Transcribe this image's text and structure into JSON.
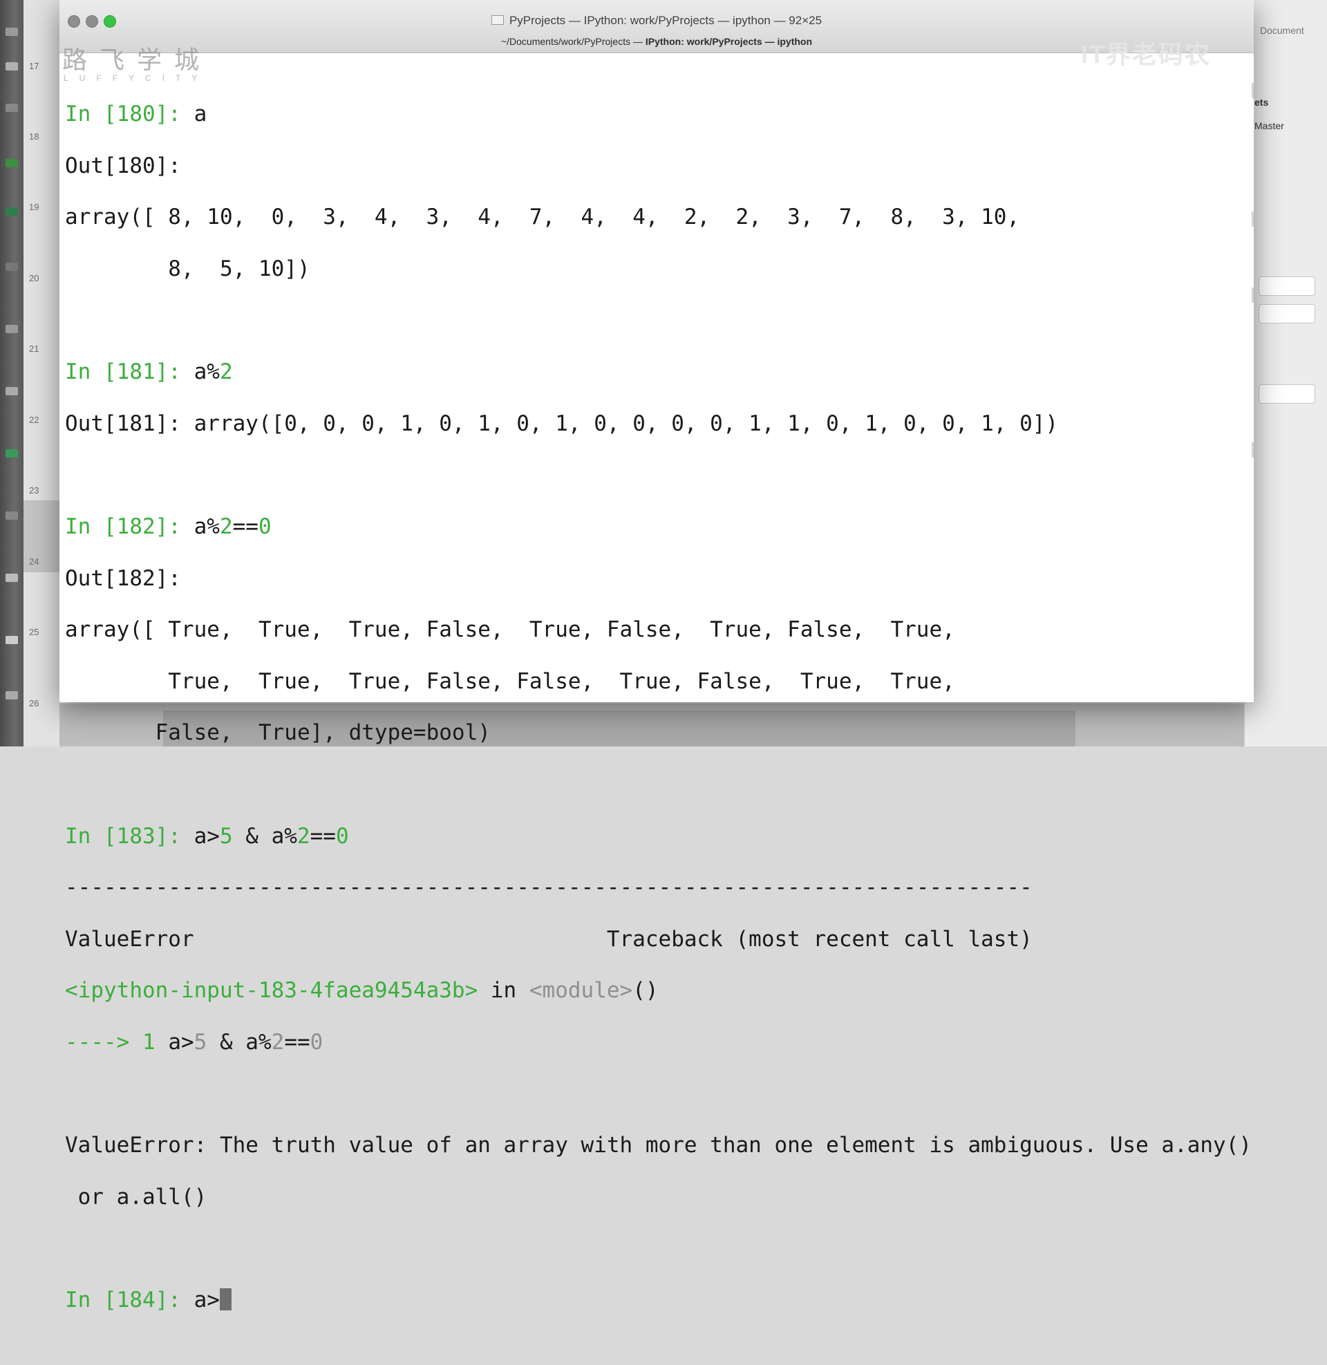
{
  "window": {
    "title": "PyProjects — IPython: work/PyProjects — ipython — 92×25",
    "tab_path": "~/Documents/work/PyProjects — ",
    "tab_bold": "IPython: work/PyProjects — ipython"
  },
  "watermark": {
    "logo_text": "路飞学城",
    "logo_sub": "LUFFYCITY",
    "right_text": "IT界老码农"
  },
  "background": {
    "ruler_numbers": [
      "17",
      "18",
      "19",
      "20",
      "21",
      "22",
      "23",
      "24",
      "25",
      "26"
    ],
    "right_panel": {
      "document_label": "Document",
      "ets_label": "ets",
      "master_label": "Master"
    }
  },
  "terminal": {
    "in180": {
      "prompt": "In [180]: ",
      "code": "a"
    },
    "out180": {
      "label": "Out[180]:",
      "line1": "array([ 8, 10,  0,  3,  4,  3,  4,  7,  4,  4,  2,  2,  3,  7,  8,  3, 10,",
      "line2": "        8,  5, 10])"
    },
    "in181": {
      "prompt": "In [181]: ",
      "code_a": "a%",
      "code_num": "2"
    },
    "out181": {
      "label": "Out[181]: ",
      "value": "array([0, 0, 0, 1, 0, 1, 0, 1, 0, 0, 0, 0, 1, 1, 0, 1, 0, 0, 1, 0])"
    },
    "in182": {
      "prompt": "In [182]: ",
      "code_a": "a%",
      "code_num1": "2",
      "code_eq": "==",
      "code_num2": "0"
    },
    "out182": {
      "label": "Out[182]:",
      "line1": "array([ True,  True,  True, False,  True, False,  True, False,  True,",
      "line2": "        True,  True,  True, False, False,  True, False,  True,  True,",
      "line3": "       False,  True], dtype=bool)"
    },
    "in183": {
      "prompt": "In [183]: ",
      "code_a": "a>",
      "code_n1": "5",
      "code_b": " & a%",
      "code_n2": "2",
      "code_eq": "==",
      "code_n3": "0"
    },
    "traceback": {
      "dashes": "---------------------------------------------------------------------------",
      "header_left": "ValueError",
      "header_right": "Traceback (most recent call last)",
      "input_ref": "<ipython-input-183-4faea9454a3b>",
      "in_word": " in ",
      "module": "<module>",
      "parens": "()",
      "arrow": "----> 1 ",
      "arrow_code_a": "a>",
      "arrow_code_n1": "5",
      "arrow_code_b": " & a%",
      "arrow_code_n2": "2",
      "arrow_code_eq": "==",
      "arrow_code_n3": "0",
      "error_line1": "ValueError: The truth value of an array with more than one element is ambiguous. Use a.any()",
      "error_line2": " or a.all()"
    },
    "in184": {
      "prompt": "In [184]: ",
      "code": "a>"
    }
  }
}
